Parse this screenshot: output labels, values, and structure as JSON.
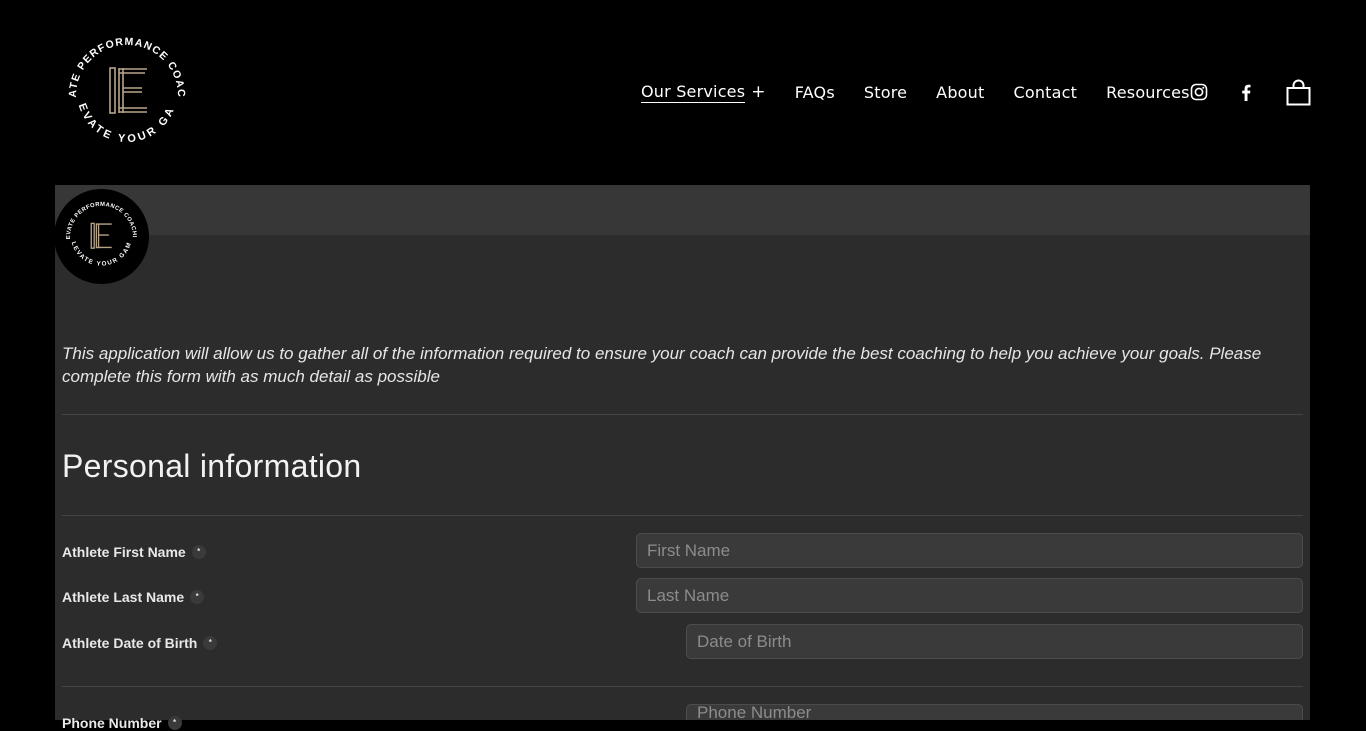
{
  "header": {
    "logo": {
      "top_text": "ELEVATE PERFORMANCE COACHING",
      "bottom_text": "ELEVATE YOUR GAME",
      "monogram": "E"
    },
    "nav": [
      {
        "label": "Our Services",
        "active": true,
        "has_submenu": true
      },
      {
        "label": "FAQs"
      },
      {
        "label": "Store"
      },
      {
        "label": "About"
      },
      {
        "label": "Contact"
      },
      {
        "label": "Resources"
      }
    ],
    "icons": [
      "instagram-icon",
      "facebook-icon",
      "shopping-bag-icon"
    ]
  },
  "form": {
    "intro": "This application will allow us to gather all of the information required to ensure your coach can provide the best coaching to help you achieve your goals. Please complete this form with as much detail as possible",
    "section_title": "Personal information",
    "required_marker": "*",
    "fields": [
      {
        "label": "Athlete First Name",
        "placeholder": "First Name"
      },
      {
        "label": "Athlete Last Name",
        "placeholder": "Last Name"
      },
      {
        "label": "Athlete Date of Birth",
        "placeholder": "Date of Birth"
      },
      {
        "label": "Phone Number",
        "placeholder": "Phone Number"
      }
    ]
  },
  "colors": {
    "page_background": "#000000",
    "panel_background": "#2c2c2c",
    "logo_accent": "#b7a58a"
  }
}
